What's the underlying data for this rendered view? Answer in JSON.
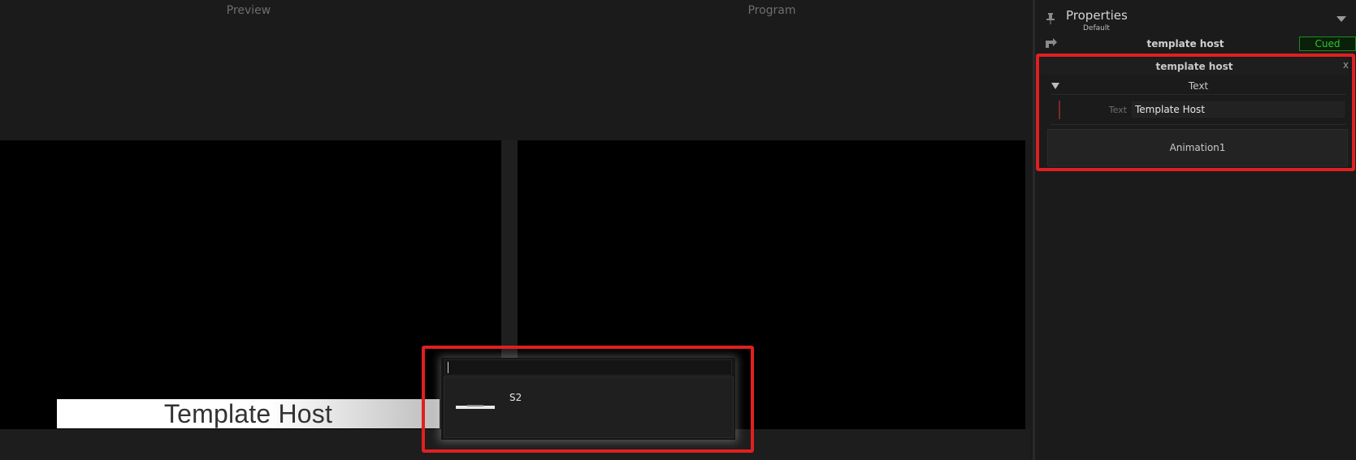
{
  "workspace": {
    "preview_title": "Preview",
    "program_title": "Program",
    "preview_graphic_text": "Template Host"
  },
  "popup": {
    "search_value": "",
    "items": [
      {
        "label": "S2"
      }
    ]
  },
  "properties": {
    "title": "Properties",
    "subtitle": "Default",
    "item_name": "template host",
    "status": "Cued",
    "status_color": "#2ec42e",
    "template": {
      "title": "template host",
      "close_glyph": "x",
      "group": {
        "label": "Text",
        "fields": [
          {
            "label": "Text",
            "value": "Template Host"
          }
        ]
      },
      "animation_label": "Animation1"
    }
  },
  "highlight_color": "#e02020"
}
